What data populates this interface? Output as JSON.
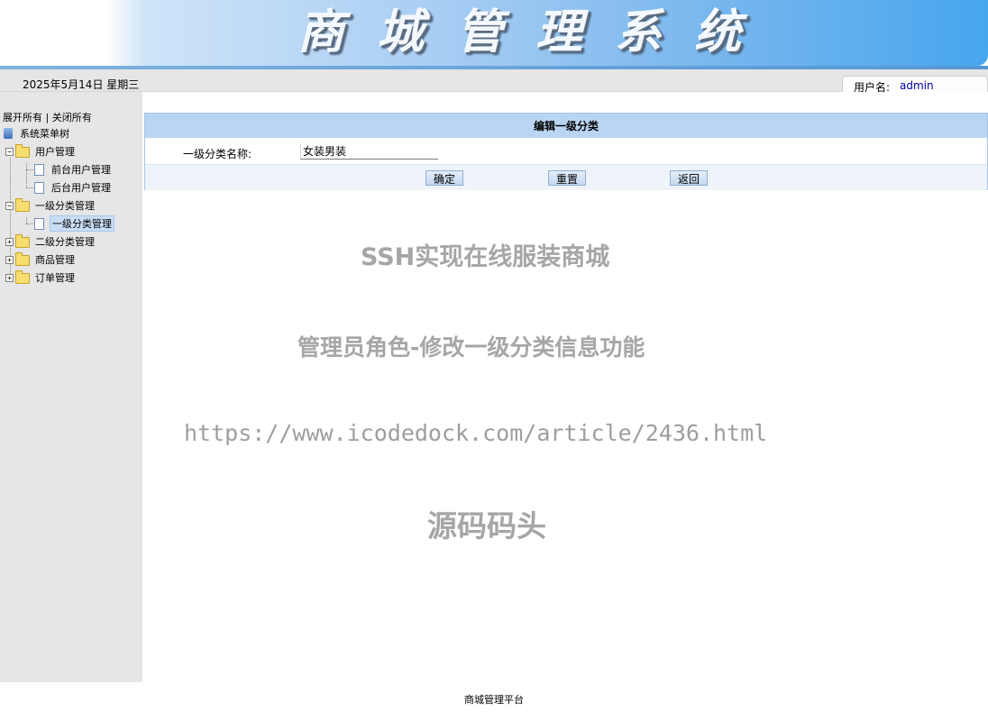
{
  "header": {
    "title": "商城管理系统"
  },
  "statusbar": {
    "date": "2025年5月14日 星期三",
    "user_label": "用户名:",
    "username": "admin"
  },
  "tree": {
    "expand_all": "展开所有",
    "separator": " | ",
    "collapse_all": "关闭所有",
    "root": "系统菜单树",
    "nodes": [
      {
        "label": "用户管理",
        "expanded": true,
        "children": [
          {
            "label": "前台用户管理"
          },
          {
            "label": "后台用户管理"
          }
        ]
      },
      {
        "label": "一级分类管理",
        "expanded": true,
        "children": [
          {
            "label": "一级分类管理",
            "selected": true
          }
        ]
      },
      {
        "label": "二级分类管理",
        "expanded": false
      },
      {
        "label": "商品管理",
        "expanded": false
      },
      {
        "label": "订单管理",
        "expanded": false
      }
    ]
  },
  "form": {
    "title": "编辑一级分类",
    "field_label": "一级分类名称:",
    "field_value": "女装男装",
    "buttons": {
      "confirm": "确定",
      "reset": "重置",
      "back": "返回"
    }
  },
  "watermark": {
    "line1": "SSH实现在线服装商城",
    "line2": "管理员角色-修改一级分类信息功能",
    "line3": "https://www.icodedock.com/article/2436.html",
    "line4": "源码码头"
  },
  "footer": {
    "text": "商城管理平台"
  },
  "colors": {
    "accent": "#47a6ee",
    "form_header": "#bad5f4",
    "sidebar": "#e6e6e6",
    "username": "#0000a0"
  }
}
